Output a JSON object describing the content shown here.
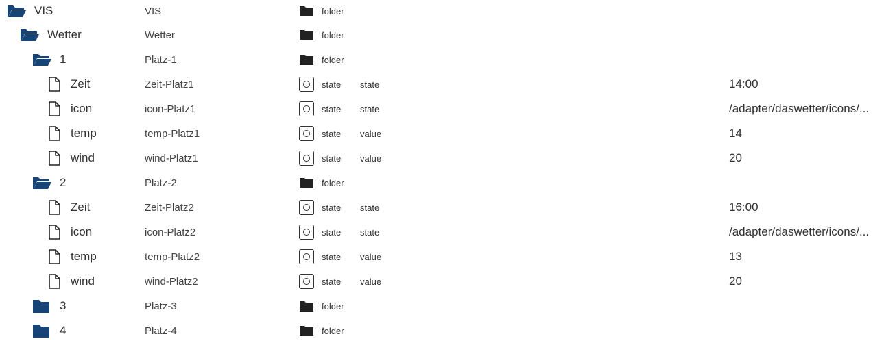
{
  "colors": {
    "folder_open": "#164477",
    "folder_closed": "#164477",
    "folder_type_icon": "#222222",
    "text": "#333333"
  },
  "rows": [
    {
      "name": "VIS",
      "displayname": "VIS",
      "type": "folder",
      "role": "",
      "value": "",
      "icon": "folder-open-icon"
    },
    {
      "name": "Wetter",
      "displayname": "Wetter",
      "type": "folder",
      "role": "",
      "value": "",
      "icon": "folder-open-icon"
    },
    {
      "name": "1",
      "displayname": "Platz-1",
      "type": "folder",
      "role": "",
      "value": "",
      "icon": "folder-open-icon"
    },
    {
      "name": "Zeit",
      "displayname": "Zeit-Platz1",
      "type": "state",
      "role": "state",
      "value": "14:00",
      "icon": "file-icon"
    },
    {
      "name": "icon",
      "displayname": "icon-Platz1",
      "type": "state",
      "role": "state",
      "value": "/adapter/daswetter/icons/...",
      "icon": "file-icon"
    },
    {
      "name": "temp",
      "displayname": "temp-Platz1",
      "type": "state",
      "role": "value",
      "value": "14",
      "icon": "file-icon"
    },
    {
      "name": "wind",
      "displayname": "wind-Platz1",
      "type": "state",
      "role": "value",
      "value": "20",
      "icon": "file-icon"
    },
    {
      "name": "2",
      "displayname": "Platz-2",
      "type": "folder",
      "role": "",
      "value": "",
      "icon": "folder-open-icon"
    },
    {
      "name": "Zeit",
      "displayname": "Zeit-Platz2",
      "type": "state",
      "role": "state",
      "value": "16:00",
      "icon": "file-icon"
    },
    {
      "name": "icon",
      "displayname": "icon-Platz2",
      "type": "state",
      "role": "state",
      "value": "/adapter/daswetter/icons/...",
      "icon": "file-icon"
    },
    {
      "name": "temp",
      "displayname": "temp-Platz2",
      "type": "state",
      "role": "value",
      "value": "13",
      "icon": "file-icon"
    },
    {
      "name": "wind",
      "displayname": "wind-Platz2",
      "type": "state",
      "role": "value",
      "value": "20",
      "icon": "file-icon"
    },
    {
      "name": "3",
      "displayname": "Platz-3",
      "type": "folder",
      "role": "",
      "value": "",
      "icon": "folder-closed-icon"
    },
    {
      "name": "4",
      "displayname": "Platz-4",
      "type": "folder",
      "role": "",
      "value": "",
      "icon": "folder-closed-icon"
    }
  ]
}
